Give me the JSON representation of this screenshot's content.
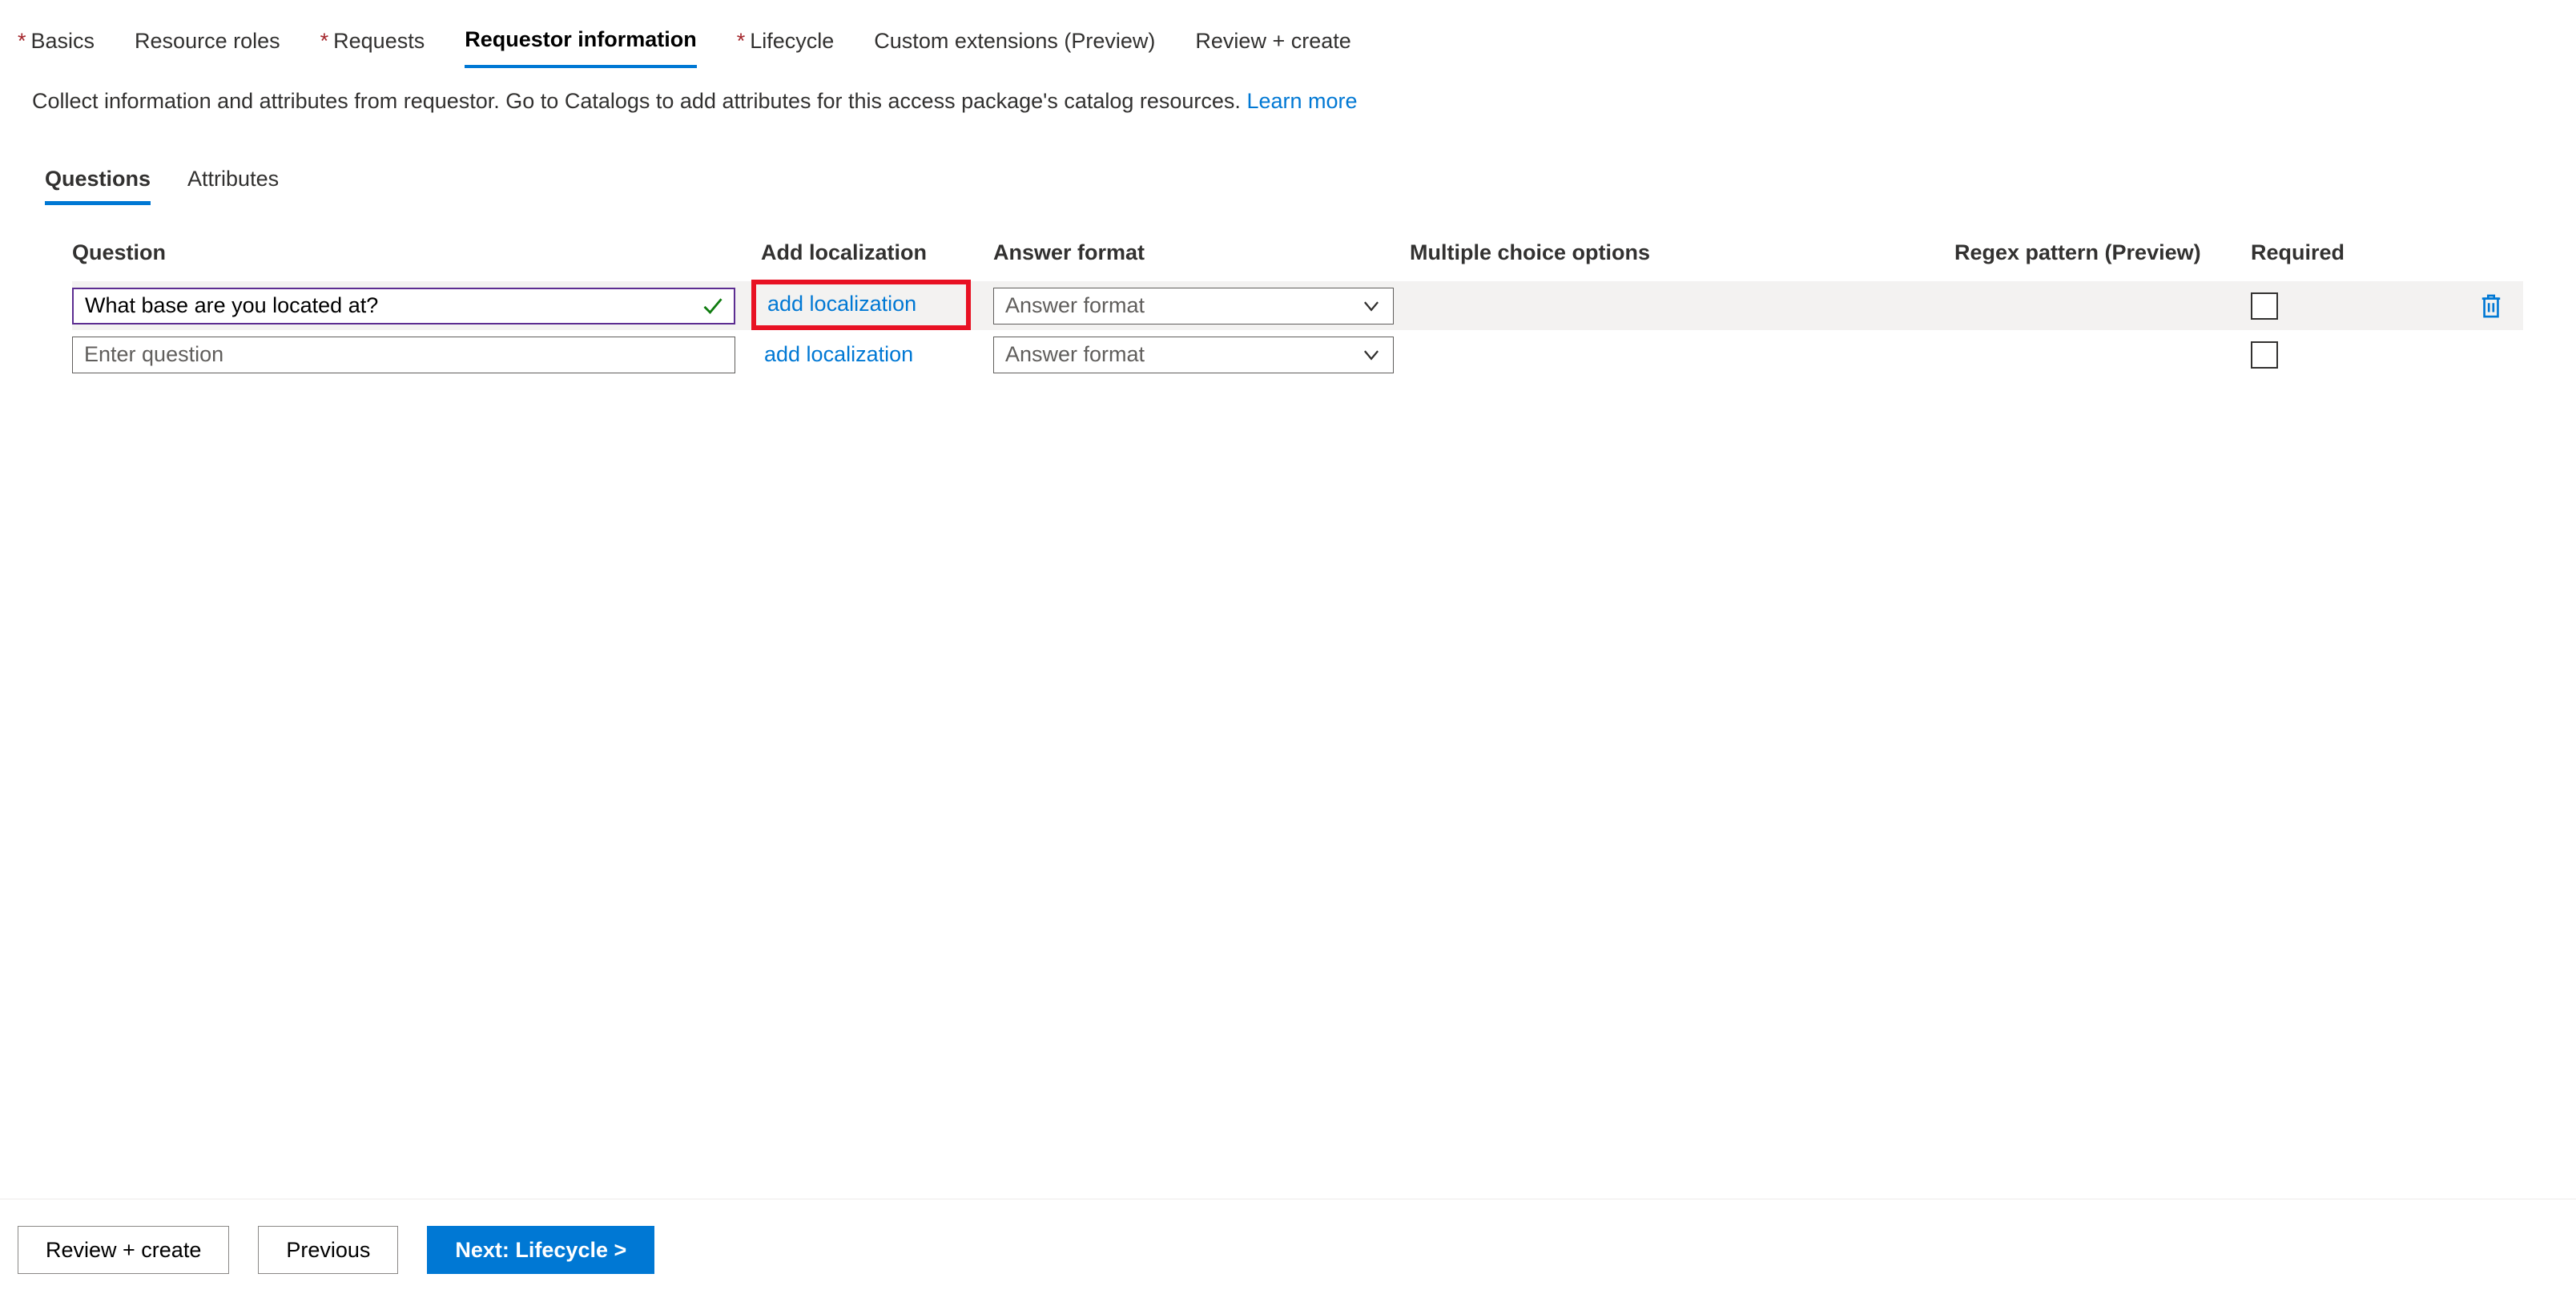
{
  "top_tabs": {
    "basics": {
      "label": "Basics",
      "required": true
    },
    "roles": {
      "label": "Resource roles",
      "required": false
    },
    "requests": {
      "label": "Requests",
      "required": true
    },
    "reqinfo": {
      "label": "Requestor information",
      "required": false
    },
    "lifecycle": {
      "label": "Lifecycle",
      "required": true
    },
    "custom": {
      "label": "Custom extensions (Preview)",
      "required": false
    },
    "review": {
      "label": "Review + create",
      "required": false
    }
  },
  "description": {
    "text": "Collect information and attributes from requestor. Go to Catalogs to add attributes for this access package's catalog resources. ",
    "learn_more": "Learn more"
  },
  "sub_tabs": {
    "questions": "Questions",
    "attributes": "Attributes"
  },
  "columns": {
    "question": "Question",
    "addloc": "Add localization",
    "answerfmt": "Answer format",
    "mco": "Multiple choice options",
    "regex": "Regex pattern (Preview)",
    "required": "Required"
  },
  "rows": [
    {
      "question_value": "What base are you located at?",
      "question_placeholder": "",
      "add_localization": "add localization",
      "answer_format_placeholder": "Answer format",
      "highlighted": true,
      "valid": true,
      "has_delete": true
    },
    {
      "question_value": "",
      "question_placeholder": "Enter question",
      "add_localization": "add localization",
      "answer_format_placeholder": "Answer format",
      "highlighted": false,
      "valid": false,
      "has_delete": false
    }
  ],
  "footer": {
    "review": "Review + create",
    "previous": "Previous",
    "next": "Next: Lifecycle >"
  }
}
